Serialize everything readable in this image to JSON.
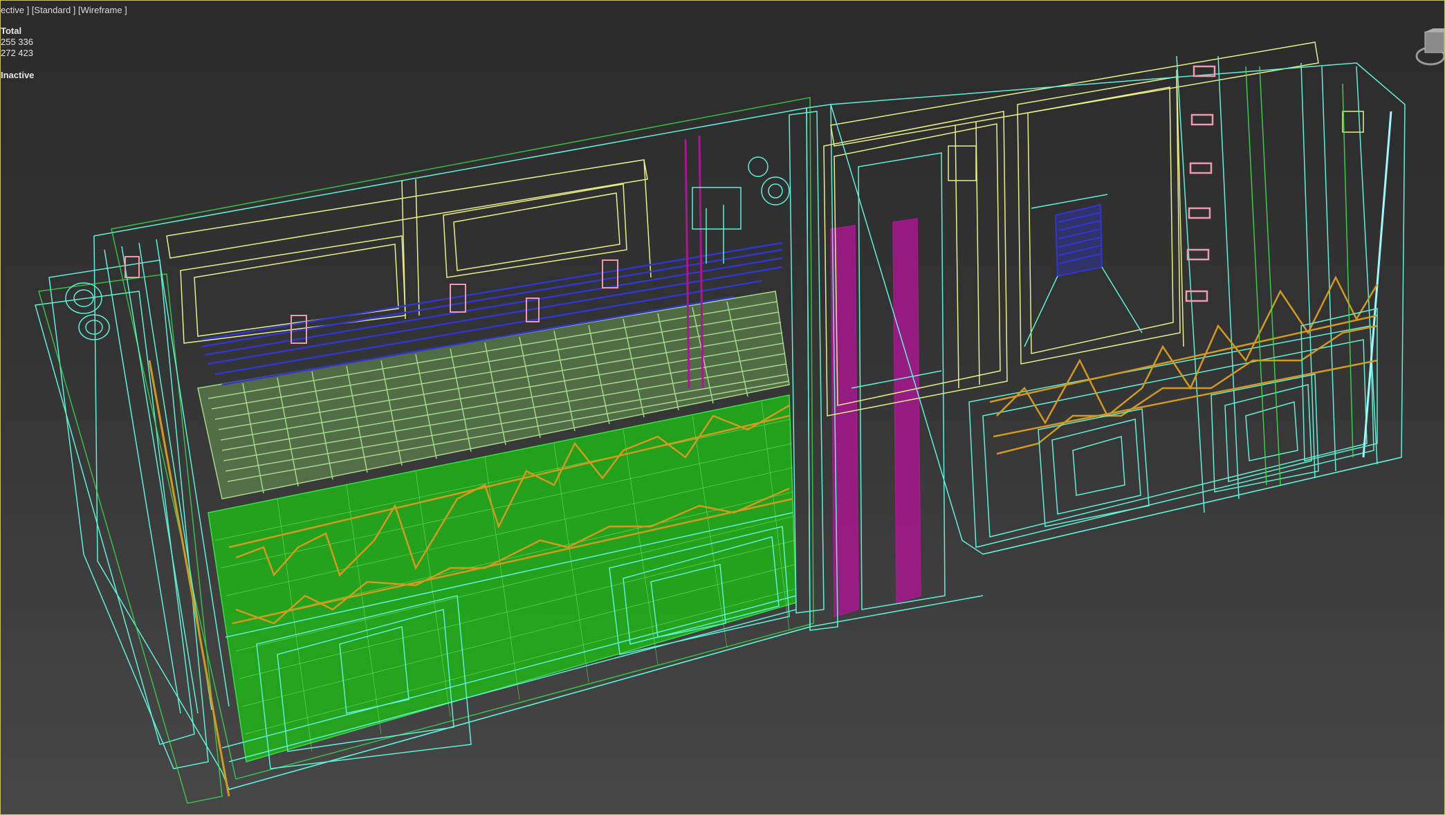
{
  "viewport": {
    "label": "ective ] [Standard ] [Wireframe ]",
    "colors": {
      "border": "#c9c36a",
      "background_top": "#2b2b2b",
      "background_bottom": "#474747",
      "wire_green": "#39e04a",
      "wire_cyan": "#5ff2d6",
      "wire_yellow": "#e8f08a",
      "wire_blue": "#3236d0",
      "wire_magenta": "#a8188f",
      "wire_orange": "#d39a1e",
      "wire_pink": "#f09ab0"
    }
  },
  "stats": {
    "header": "Total",
    "polys": "255 336",
    "verts": "272 423",
    "status": "Inactive"
  },
  "viewcube": {
    "icon": "viewcube-icon"
  }
}
